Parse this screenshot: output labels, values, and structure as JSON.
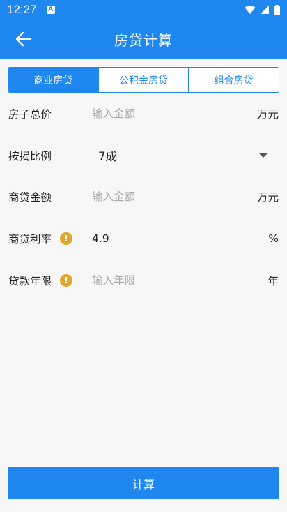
{
  "status": {
    "time": "12:27",
    "app_glyph": "A"
  },
  "header": {
    "title": "房贷计算",
    "back_icon": "arrow-left-icon"
  },
  "tabs": [
    {
      "label": "商业房贷",
      "active": true
    },
    {
      "label": "公积金房贷",
      "active": false
    },
    {
      "label": "组合房贷",
      "active": false
    }
  ],
  "form": {
    "total_price": {
      "label": "房子总价",
      "placeholder": "输入金额",
      "value": "",
      "unit": "万元"
    },
    "mortgage_ratio": {
      "label": "按揭比例",
      "value": "7成"
    },
    "loan_amount": {
      "label": "商贷金额",
      "placeholder": "输入金额",
      "value": "",
      "unit": "万元"
    },
    "interest_rate": {
      "label": "商贷利率",
      "value": "4.9",
      "placeholder": "",
      "unit": "%"
    },
    "loan_years": {
      "label": "贷款年限",
      "placeholder": "输入年限",
      "value": "",
      "unit": "年"
    }
  },
  "calculate_label": "计算",
  "colors": {
    "primary": "#1e88f0",
    "warning": "#e0a82a"
  }
}
